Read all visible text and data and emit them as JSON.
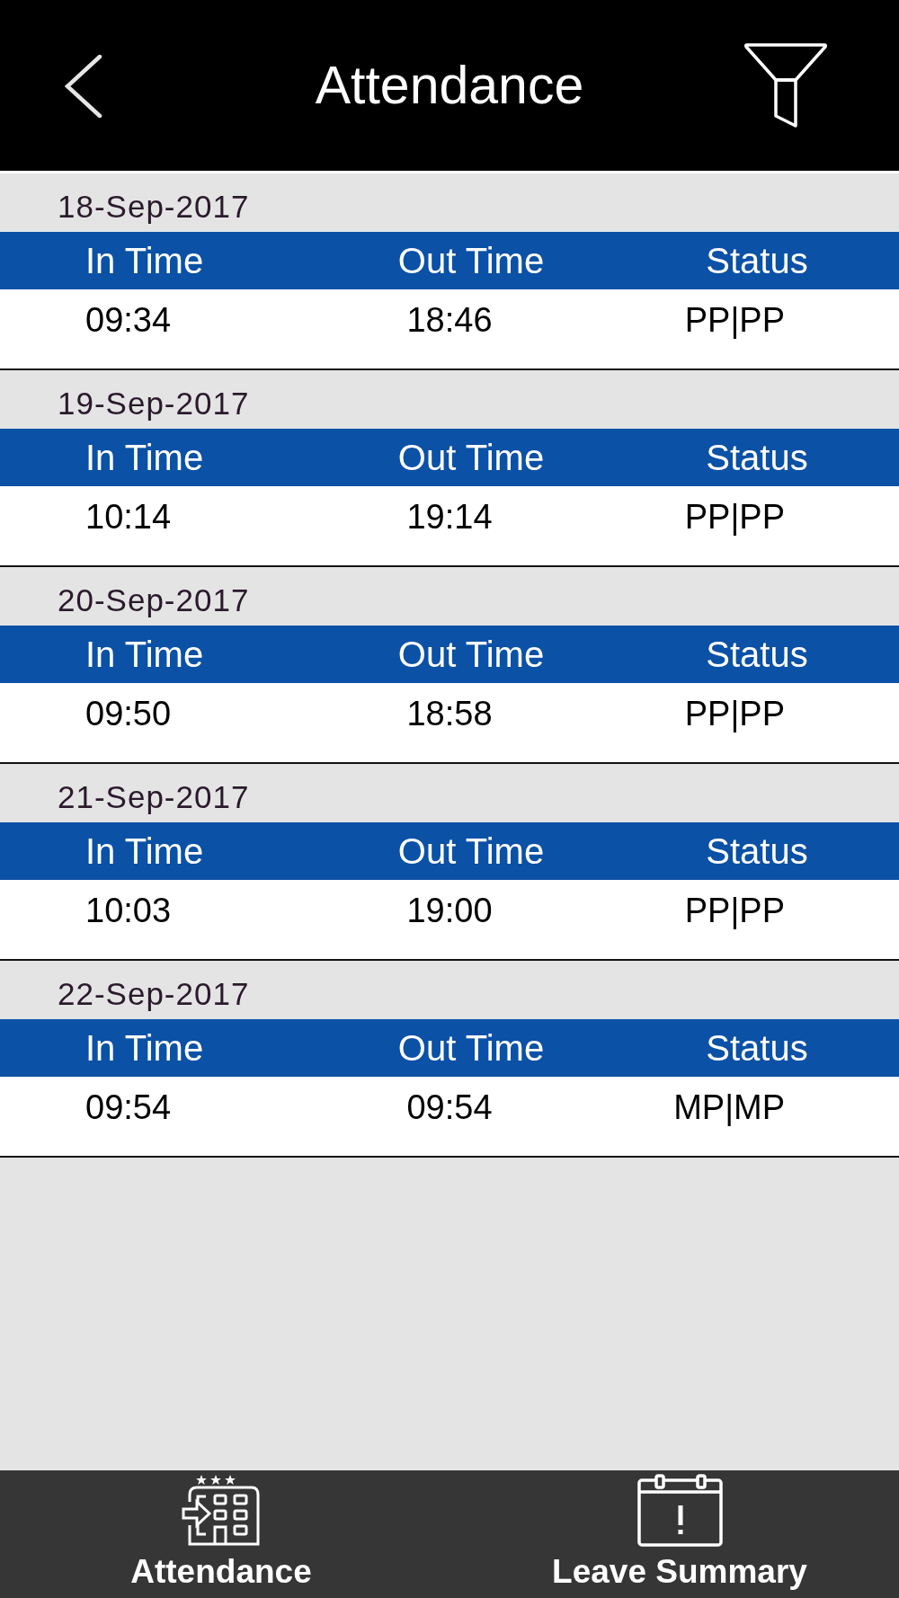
{
  "header": {
    "title": "Attendance"
  },
  "days": [
    {
      "date": "18-Sep-2017",
      "columns": [
        "In Time",
        "Out Time",
        "Status"
      ],
      "in_time": "09:34",
      "out_time": "18:46",
      "status": "PP|PP"
    },
    {
      "date": "19-Sep-2017",
      "columns": [
        "In Time",
        "Out Time",
        "Status"
      ],
      "in_time": "10:14",
      "out_time": "19:14",
      "status": "PP|PP"
    },
    {
      "date": "20-Sep-2017",
      "columns": [
        "In Time",
        "Out Time",
        "Status"
      ],
      "in_time": "09:50",
      "out_time": "18:58",
      "status": "PP|PP"
    },
    {
      "date": "21-Sep-2017",
      "columns": [
        "In Time",
        "Out Time",
        "Status"
      ],
      "in_time": "10:03",
      "out_time": "19:00",
      "status": "PP|PP"
    },
    {
      "date": "22-Sep-2017",
      "columns": [
        "In Time",
        "Out Time",
        "Status"
      ],
      "in_time": "09:54",
      "out_time": "09:54",
      "status": "MP|MP"
    }
  ],
  "tab_bar": {
    "tabs": [
      {
        "label": "Attendance",
        "kind": "attendance"
      },
      {
        "label": "Leave Summary",
        "kind": "leave"
      }
    ]
  }
}
